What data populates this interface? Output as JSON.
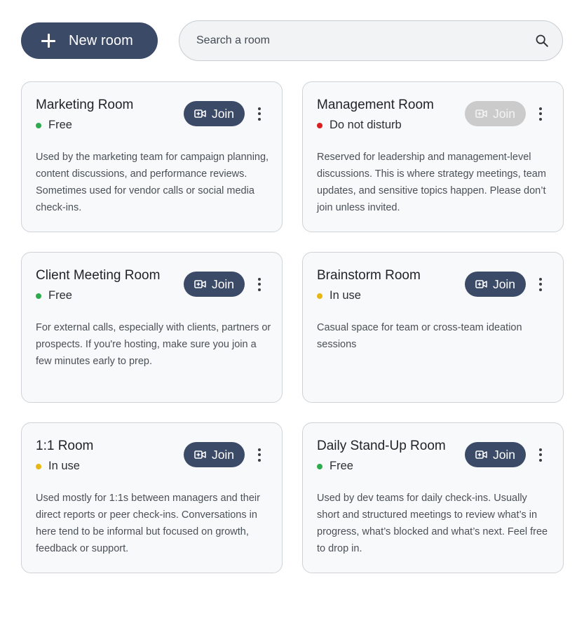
{
  "toolbar": {
    "new_room_label": "New room",
    "search_placeholder": "Search a room"
  },
  "colors": {
    "primary": "#3b4a67",
    "disabled": "#cbcbcb",
    "status_free": "#2eaa4f",
    "status_dnd": "#d91f1f",
    "status_in_use": "#e9b711"
  },
  "rooms": [
    {
      "title": "Marketing Room",
      "status": "Free",
      "status_color": "#2eaa4f",
      "join_label": "Join",
      "join_enabled": true,
      "description": "Used by the marketing team for campaign planning, content discussions, and performance reviews. Sometimes used for vendor calls or social media check-ins."
    },
    {
      "title": "Management Room",
      "status": "Do not disturb",
      "status_color": "#d91f1f",
      "join_label": "Join",
      "join_enabled": false,
      "description": "Reserved for leadership and management-level discussions. This is where strategy meetings, team updates, and sensitive topics happen. Please don’t join unless invited."
    },
    {
      "title": "Client Meeting Room",
      "status": "Free",
      "status_color": "#2eaa4f",
      "join_label": "Join",
      "join_enabled": true,
      "description": "For external calls, especially with clients, partners or prospects. If you're hosting, make sure you join a few minutes early to prep."
    },
    {
      "title": "Brainstorm Room",
      "status": "In use",
      "status_color": "#e9b711",
      "join_label": "Join",
      "join_enabled": true,
      "description": "Casual space for team or cross-team ideation sessions"
    },
    {
      "title": "1:1 Room",
      "status": "In use",
      "status_color": "#e9b711",
      "join_label": "Join",
      "join_enabled": true,
      "description": "Used mostly for 1:1s between managers and their direct reports or peer check-ins. Conversations in here tend to be informal but focused on growth, feedback or support."
    },
    {
      "title": "Daily Stand-Up Room",
      "status": "Free",
      "status_color": "#2eaa4f",
      "join_label": "Join",
      "join_enabled": true,
      "description": "Used by dev teams for daily check-ins. Usually short and structured meetings to review what’s in progress, what’s blocked and what’s next. Feel free to drop in."
    }
  ]
}
